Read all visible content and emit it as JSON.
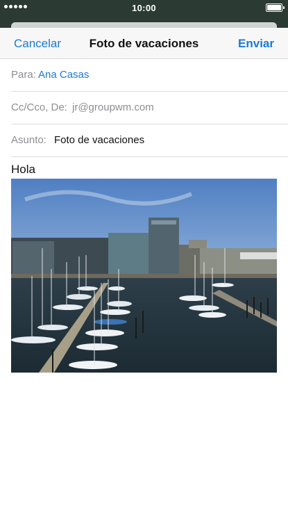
{
  "status_bar": {
    "time": "10:00",
    "signal_bars": 5,
    "battery_level": 1.0
  },
  "compose": {
    "cancel_label": "Cancelar",
    "title": "Foto de vacaciones",
    "send_label": "Enviar",
    "to_label": "Para:",
    "to_value": "Ana Casas",
    "cc_label": "Cc/Cco, De:",
    "cc_value": "jr@groupwm.com",
    "subject_label": "Asunto:",
    "subject_value": "Foto de vacaciones",
    "body_text": "Hola",
    "attachment_icon": "harbor-photo"
  },
  "colors": {
    "accent": "#1a7ad8",
    "status_bar_bg": "#2b3a33",
    "label_gray": "#8e8e93"
  }
}
